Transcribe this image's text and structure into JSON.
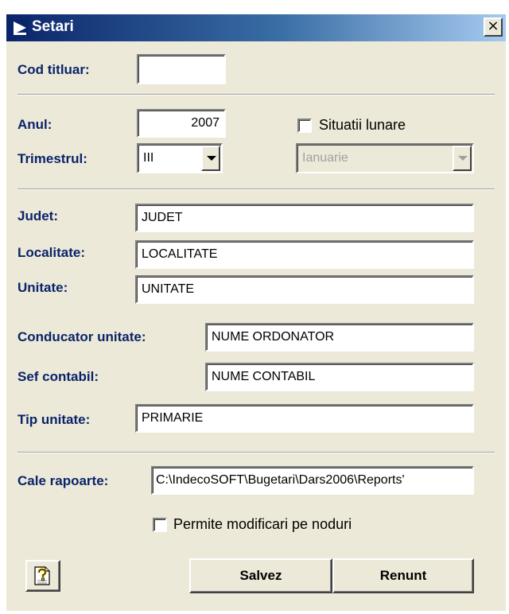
{
  "window": {
    "title": "Setari",
    "close_glyph": "×"
  },
  "labels": {
    "cod_titluar": "Cod titluar:",
    "anul": "Anul:",
    "trimestrul": "Trimestrul:",
    "judet": "Judet:",
    "localitate": "Localitate:",
    "unitate": "Unitate:",
    "conducator_unitate": "Conducator unitate:",
    "sef_contabil": "Sef contabil:",
    "tip_unitate": "Tip unitate:",
    "cale_rapoarte": "Cale rapoarte:"
  },
  "fields": {
    "cod_titluar": "",
    "anul": "2007",
    "trimestrul": "III",
    "luna": "Ianuarie",
    "judet": "JUDET",
    "localitate": "LOCALITATE",
    "unitate": "UNITATE",
    "conducator_unitate": "NUME ORDONATOR",
    "sef_contabil": "NUME CONTABIL",
    "tip_unitate": "PRIMARIE",
    "cale_rapoarte": "C:\\IndecoSOFT\\Bugetari\\Dars2006\\Reports'"
  },
  "checkboxes": {
    "situatii_lunare": {
      "label": "Situatii lunare",
      "checked": false
    },
    "permite_modificari": {
      "label": "Permite modificari pe noduri",
      "checked": false
    }
  },
  "buttons": {
    "salvez": "Salvez",
    "renunt": "Renunt"
  },
  "icons": {
    "title_icon": "play-arrow-icon",
    "help_icon": "help-question-icon"
  },
  "colors": {
    "label_color": "#0a246a",
    "window_bg": "#ece9d8",
    "title_bar_start": "#0a246a",
    "title_bar_end": "#a6caf0"
  }
}
